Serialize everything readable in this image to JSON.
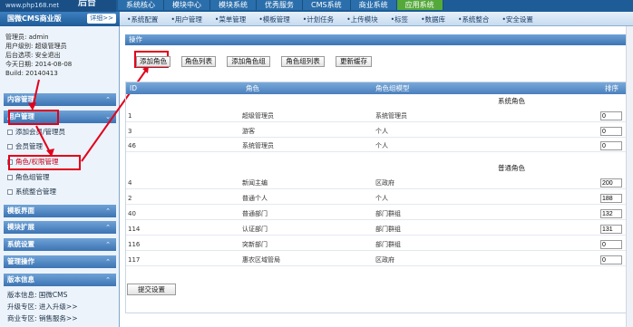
{
  "topbar": {
    "logo_text": "www.php168.net",
    "logo_big": "后台",
    "tabs": [
      "系统核心",
      "模块中心",
      "模块系统",
      "优秀服务",
      "CMS系统",
      "商业系统",
      "应用系统"
    ],
    "active_tab": 6
  },
  "subbar": {
    "brand": "国微CMS商业版",
    "detail": "详细>>",
    "nav": [
      "系统配置",
      "用户管理",
      "菜单管理",
      "模板管理",
      "计划任务",
      "上传模块",
      "标签",
      "数据库",
      "系统整合",
      "安全设置"
    ]
  },
  "userinfo": {
    "admin": "管理员: admin",
    "group": "用户级别: 超级管理员",
    "status": "后台选项: 安全退出",
    "date": "今天日期: 2014-08-08",
    "build": "Build: 20140413"
  },
  "sidebar": {
    "sections": [
      "内容管理",
      "用户管理",
      "模板界面",
      "模块扩展",
      "系统设置",
      "管理操作",
      "版本信息"
    ],
    "user_items": [
      "添加会员/管理员",
      "会员管理",
      "角色/权限管理",
      "角色组管理",
      "系统整合管理"
    ],
    "version": {
      "line1": "版本信息: 国微CMS",
      "line2": "升级专区: 进入升级>>",
      "line3": "商业专区: 销售服务>>"
    }
  },
  "ops": {
    "title": "操作",
    "buttons": [
      "添加角色",
      "角色列表",
      "添加角色组",
      "角色组列表",
      "更新缓存"
    ]
  },
  "grid": {
    "headers": [
      "ID",
      "角色",
      "角色组模型",
      "排序"
    ],
    "groups": [
      "系统角色",
      "普通角色"
    ],
    "system_rows": [
      {
        "id": "1",
        "name": "超级管理员",
        "model": "系统管理员",
        "sort": "0"
      },
      {
        "id": "3",
        "name": "游客",
        "model": "个人",
        "sort": "0"
      },
      {
        "id": "46",
        "name": "系统管理员",
        "model": "个人",
        "sort": "0"
      }
    ],
    "normal_rows": [
      {
        "id": "4",
        "name": "新闻主编",
        "model": "区政府",
        "sort": "200"
      },
      {
        "id": "2",
        "name": "普通个人",
        "model": "个人",
        "sort": "188"
      },
      {
        "id": "40",
        "name": "普通部门",
        "model": "部门群组",
        "sort": "132"
      },
      {
        "id": "114",
        "name": "认证部门",
        "model": "部门群组",
        "sort": "131"
      },
      {
        "id": "116",
        "name": "突新部门",
        "model": "部门群组",
        "sort": "0"
      },
      {
        "id": "117",
        "name": "惠农区域管局",
        "model": "区政府",
        "sort": "0"
      }
    ]
  },
  "submit_label": "提交设置",
  "colors": {
    "accent": "#1d5c97",
    "highlight": "#e2001a",
    "active_tab": "#55a93a"
  }
}
